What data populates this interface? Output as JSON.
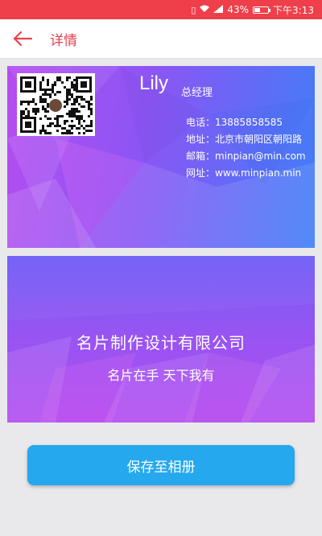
{
  "status_bar": {
    "battery": "43%",
    "battery_level": 0.43,
    "time": "下午3:13",
    "icons": [
      "vibrate-icon",
      "wifi-icon",
      "signal-icon",
      "battery-icon"
    ]
  },
  "app_bar": {
    "back_icon": "arrow-left-icon",
    "title": "详情"
  },
  "card_front": {
    "name": "Lily",
    "position": "总经理",
    "phone": "电话：13885858585",
    "address": "地址：北京市朝阳区朝阳路",
    "email": "邮箱：minpian@min.com",
    "website": "网址：www.minpian.min"
  },
  "card_back": {
    "company": "名片制作设计有限公司",
    "slogan": "名片在手 天下我有"
  },
  "actions": {
    "save_label": "保存至相册"
  },
  "colors": {
    "status_bar": "#ef3f4a",
    "accent": "#e8414d",
    "button": "#25a8ee",
    "card_purple": "#b64df0",
    "card_blue": "#3f7ef8"
  }
}
